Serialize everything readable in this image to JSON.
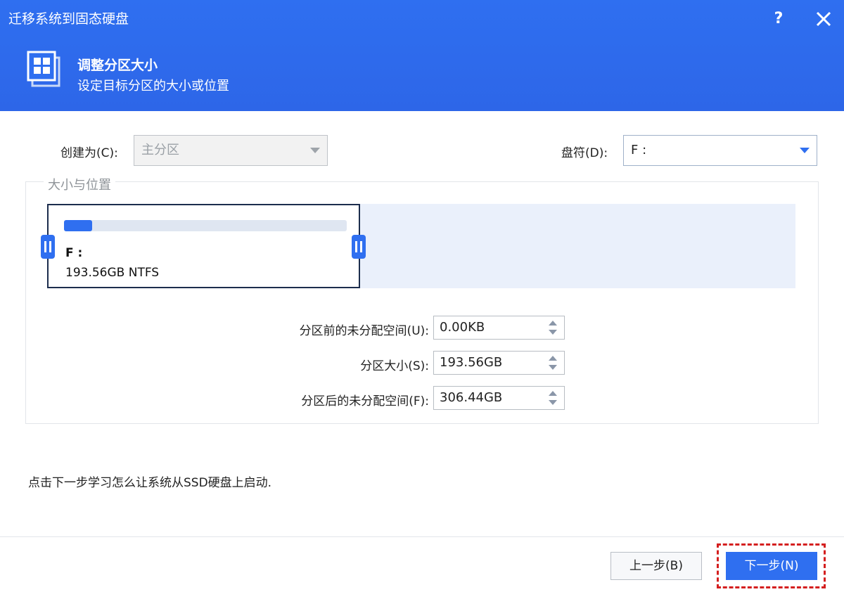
{
  "window": {
    "title": "迁移系统到固态硬盘",
    "help_label": "?"
  },
  "step": {
    "title": "调整分区大小",
    "subtitle": "设定目标分区的大小或位置"
  },
  "form": {
    "create_as_label": "创建为(C):",
    "create_as_value": "主分区",
    "drive_letter_label": "盘符(D):",
    "drive_letter_value": "F :"
  },
  "size_position": {
    "legend": "大小与位置",
    "partition": {
      "letter": "F :",
      "size_fs": "193.56GB NTFS",
      "usage_fraction": 0.1
    },
    "fields": [
      {
        "label": "分区前的未分配空间(U):",
        "value": "0.00KB"
      },
      {
        "label": "分区大小(S):",
        "value": "193.56GB"
      },
      {
        "label": "分区后的未分配空间(F):",
        "value": "306.44GB"
      }
    ]
  },
  "hint": "点击下一步学习怎么让系统从SSD硬盘上启动.",
  "buttons": {
    "back_label": "上一步(B)",
    "next_label": "下一步(N)"
  },
  "colors": {
    "accent": "#2f6ff0",
    "highlight": "#d41f1f",
    "partition_border": "#1c2d4d"
  }
}
